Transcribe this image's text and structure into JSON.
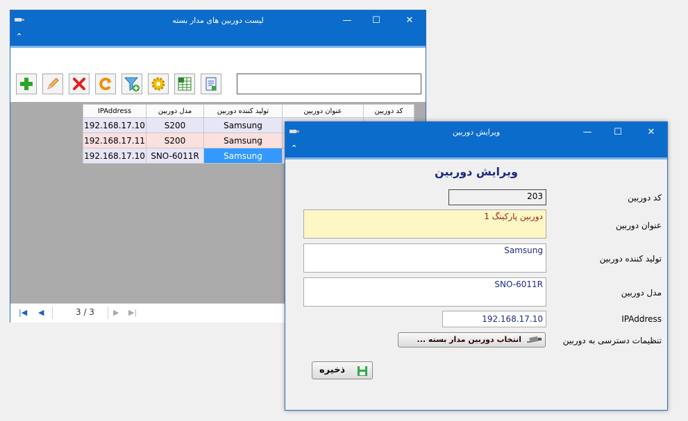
{
  "list_window": {
    "title": "لیست دوربین های مدار بسته",
    "window_controls": {
      "minimize": "—",
      "maximize": "☐",
      "close": "✕"
    },
    "ribbon_toggle": "⌃",
    "toolbar": {
      "buttons": [
        {
          "name": "add",
          "icon": "plus-icon"
        },
        {
          "name": "edit",
          "icon": "pencil-icon"
        },
        {
          "name": "delete",
          "icon": "x-icon"
        },
        {
          "name": "refresh",
          "icon": "refresh-icon"
        },
        {
          "name": "filter",
          "icon": "funnel-icon"
        },
        {
          "name": "settings",
          "icon": "gear-icon"
        },
        {
          "name": "excel",
          "icon": "spreadsheet-icon"
        },
        {
          "name": "report",
          "icon": "report-icon"
        }
      ],
      "search_value": ""
    },
    "grid": {
      "columns": [
        "IPAddress",
        "مدل دوربین",
        "تولید کننده دوربین",
        "عنوان دوربین",
        "کد دوربین"
      ],
      "rows": [
        {
          "ip": "192.168.17.10",
          "model": "S200",
          "maker": "Samsung",
          "title": "",
          "code": ""
        },
        {
          "ip": "192.168.17.11",
          "model": "S200",
          "maker": "Samsung",
          "title": "",
          "code": ""
        },
        {
          "ip": "192.168.17.10",
          "model": "SNO-6011R",
          "maker": "Samsung",
          "title": "",
          "code": ""
        }
      ]
    },
    "pager": {
      "text": "3 / 3"
    }
  },
  "edit_window": {
    "title": "ویرایش دوربین",
    "window_controls": {
      "minimize": "—",
      "maximize": "☐",
      "close": "✕"
    },
    "ribbon_toggle": "⌃",
    "form_title": "ویرایش دوربین",
    "fields": {
      "code": {
        "label": "کد دوربین",
        "value": "203"
      },
      "title": {
        "label": "عنوان دوربین",
        "value": "دوربین پارکینگ 1"
      },
      "maker": {
        "label": "تولید کننده دوربین",
        "value": "Samsung"
      },
      "model": {
        "label": "مدل دوربین",
        "value": "SNO-6011R"
      },
      "ip": {
        "label": "IPAddress",
        "value": "192.168.17.10"
      },
      "access": {
        "label": "تنظیمات دسترسی به دوربین",
        "button_label": "انتخاب دوربین مدار بسته ..."
      }
    },
    "save_label": "ذخیره"
  },
  "colors": {
    "titlebar": "#0c6ccc",
    "selection": "#3399ff",
    "row_alt": "#fbe0e0",
    "row": "#e6e6f6"
  }
}
